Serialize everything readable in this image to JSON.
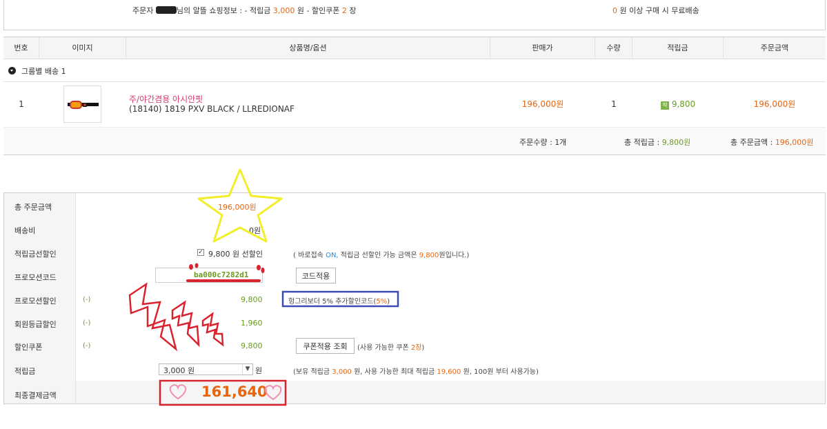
{
  "info": {
    "prefix": "주문자",
    "suffix_1": "님의 알뜰 쇼핑정보 : - 적립금",
    "points": "3,000",
    "suffix_2": "원 - 할인쿠폰",
    "coupons": "2",
    "suffix_3": "장",
    "free_amount": "0",
    "free_text": "원 이상 구매 시 무료배송"
  },
  "table": {
    "headers": [
      "번호",
      "이미지",
      "상품명/옵션",
      "판매가",
      "수량",
      "적립금",
      "주문금액"
    ],
    "group_label": "그룹별 배송 1",
    "row": {
      "no": "1",
      "name": "주/야간겸용 아시안핏",
      "option": "(18140) 1819 PXV BLACK / LLREDIONAF",
      "price": "196,000원",
      "qty": "1",
      "points_badge": "적",
      "points": "9,800",
      "amount": "196,000원"
    },
    "summary": {
      "qty_label": "주문수량 :",
      "qty_value": "1개",
      "points_label": "총 적립금 :",
      "points_value": "9,800원",
      "total_label": "총 주문금액 :",
      "total_value": "196,000원"
    }
  },
  "payment": {
    "labels": {
      "total": "총 주문금액",
      "shipping": "배송비",
      "points_discount": "적립금선할인",
      "promo_code": "프로모션코드",
      "promo_discount": "프로모션할인",
      "member_discount": "회원등급할인",
      "coupon": "할인쿠폰",
      "points": "적립금",
      "final": "최종결제금액"
    },
    "total_value": "196,000원",
    "shipping_value": "0원",
    "points_discount_check": "✓",
    "points_discount_value": "9,800 원 선할인",
    "points_discount_note_1": "( 바로접속",
    "points_discount_note_on": "ON,",
    "points_discount_note_2": "적립금 선할인 가능 금액은",
    "points_discount_note_amount": "9,800",
    "points_discount_note_3": "원입니다.)",
    "promo_code_value": "ba000c7282d1",
    "promo_apply_button": "코드적용",
    "minus_sign": "(-)",
    "promo_discount_value": "9,800",
    "promo_note_1": "헝그리보더 5% 추가할인코드(",
    "promo_note_pct": "5%",
    "promo_note_2": ")",
    "member_discount_value": "1,960",
    "coupon_value": "9,800",
    "coupon_button": "쿠폰적용 조회",
    "coupon_note_1": "(사용 가능한 쿠폰",
    "coupon_note_count": "2장",
    "coupon_note_2": ")",
    "points_select": "3,000 원",
    "points_unit": "원",
    "points_note_1": "(보유 적립금",
    "points_note_held": "3,000",
    "points_note_2": "원, 사용 가능한 최대 적립금",
    "points_note_max": "19,600",
    "points_note_3": "원, 100원 부터 사용가능)",
    "final_value": "161,640"
  },
  "colors": {
    "accent_orange": "#e8650f",
    "accent_green": "#6a9a1e",
    "product_pink": "#d9366f",
    "annot_red": "#d9232e",
    "annot_yellow": "#f2ee2a",
    "annot_blue": "#3b4bb5"
  }
}
